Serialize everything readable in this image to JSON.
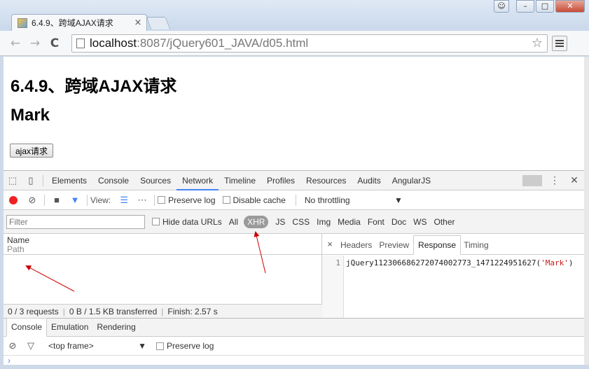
{
  "window": {
    "user_icon": "user-icon",
    "minimize": "–",
    "maximize": "□",
    "close": "✕"
  },
  "tab": {
    "title": "6.4.9、跨域AJAX请求",
    "close": "×"
  },
  "toolbar": {
    "back": "←",
    "forward": "→",
    "reload": "C",
    "url_host": "localhost",
    "url_path": ":8087/jQuery601_JAVA/d05.html",
    "star": "☆"
  },
  "page": {
    "heading": "6.4.9、跨域AJAX请求",
    "subheading": "Mark",
    "ajax_button": "ajax请求"
  },
  "devtools": {
    "tabs": [
      "Elements",
      "Console",
      "Sources",
      "Network",
      "Timeline",
      "Profiles",
      "Resources",
      "Audits",
      "AngularJS"
    ],
    "active_tab": "Network",
    "network_toolbar": {
      "view_label": "View:",
      "preserve_log": "Preserve log",
      "disable_cache": "Disable cache",
      "throttling": "No throttling"
    },
    "filter": {
      "placeholder": "Filter",
      "hide_data_urls": "Hide data URLs",
      "types": [
        "All",
        "XHR",
        "JS",
        "CSS",
        "Img",
        "Media",
        "Font",
        "Doc",
        "WS",
        "Other"
      ],
      "selected_type": "XHR"
    },
    "columns": {
      "name": "Name",
      "path": "Path"
    },
    "status": {
      "requests": "0 / 3 requests",
      "transferred": "0 B / 1.5 KB transferred",
      "finish": "Finish: 2.57 s"
    },
    "detail_tabs": [
      "Headers",
      "Preview",
      "Response",
      "Timing"
    ],
    "active_detail_tab": "Response",
    "response": {
      "line_number": "1",
      "callback": "jQuery112306686272074002773_1471224951627(",
      "string": "'Mark'",
      "close": ")"
    },
    "drawer": {
      "tabs": [
        "Console",
        "Emulation",
        "Rendering"
      ],
      "active": "Console",
      "frame": "<top frame>",
      "preserve_log": "Preserve log",
      "prompt": "›"
    }
  },
  "colors": {
    "accent": "#4285f4",
    "record": "#ee2222",
    "string": "#c41a16",
    "annotation_arrow": "#cc0000"
  }
}
